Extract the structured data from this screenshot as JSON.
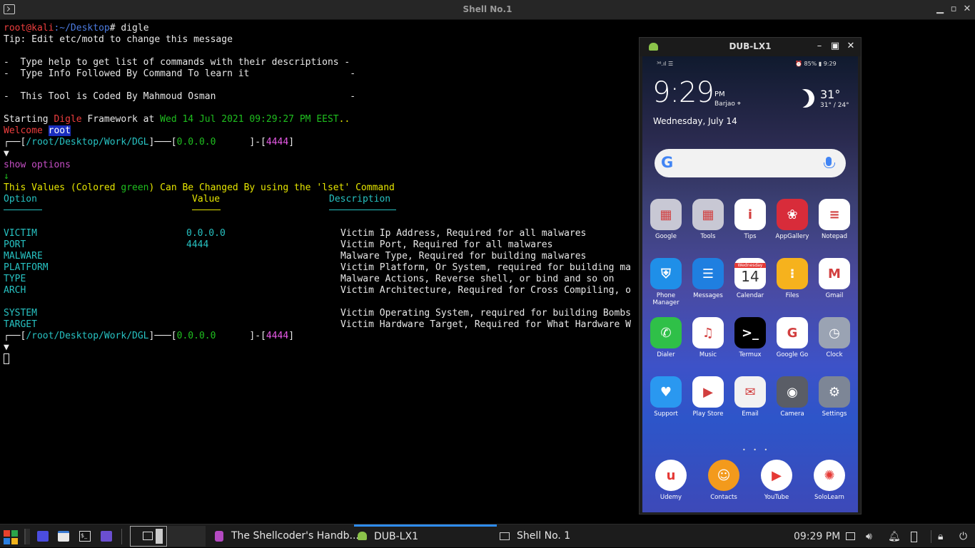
{
  "window": {
    "title": "Shell No.1",
    "controls": [
      "minimize",
      "maximize",
      "close"
    ]
  },
  "terminal": {
    "prompt_user": "root@kali",
    "prompt_path": ":~/Desktop",
    "prompt_suffix": "# ",
    "command": "digle",
    "tip": "Tip: Edit etc/motd to change this message",
    "banner1": "-  Type help to get list of commands with their descriptions -",
    "banner2": "-  Type Info Followed By Command To learn it                  -",
    "banner3": "-  This Tool is Coded By Mahmoud Osman                        -",
    "starting_pre": "Starting ",
    "starting_name": "Digle",
    "starting_mid": " Framework at ",
    "starting_date": "Wed 14 Jul 2021 09:29:27 PM EEST",
    "starting_dots": "..",
    "welcome": "Welcome ",
    "welcome_user": "root",
    "p_box_open": "┌──[",
    "p_path": "/root/Desktop/Work/DGL",
    "p_mid": "]───[",
    "p_ip": "0.0.0.0      ",
    "p_sep": "]-[",
    "p_port": "4444",
    "p_close": "]",
    "p_arrow": "▼",
    "cmd2": "show options",
    "cmd2_arrow": "↓",
    "values_pre": "This Values (Colored ",
    "values_green": "green",
    "values_post": ") Can Be Changed By using the 'lset' Command",
    "headers": {
      "option": "Option",
      "value": "Value",
      "description": "Description"
    },
    "options": [
      {
        "name": "VICTIM",
        "value": "0.0.0.0",
        "desc": "Victim Ip Address, Required for all malwares"
      },
      {
        "name": "PORT",
        "value": "4444",
        "desc": "Victim Port, Required for all malwares"
      },
      {
        "name": "MALWARE",
        "value": "",
        "desc": "Malware Type, Required for building malwares"
      },
      {
        "name": "PLATFORM",
        "value": "",
        "desc": "Victim Platform, Or System, required for building ma"
      },
      {
        "name": "TYPE",
        "value": "",
        "desc": "Malware Actions, Reverse shell, or bind and so on"
      },
      {
        "name": "ARCH",
        "value": "",
        "desc": "Victim Architecture, Required for Cross Compiling, o"
      },
      {
        "name": "SYSTEM",
        "value": "",
        "desc": "Victim Operating System, required for building Bombs"
      },
      {
        "name": "TARGET",
        "value": "",
        "desc": "Victim Hardware Target, Required for What Hardware W"
      }
    ]
  },
  "phone_window": {
    "title": "DUB-LX1",
    "status_left": "³⁶.ıl ☰",
    "status_right": "⏰ 85% ▮ 9:29",
    "clock_time": "9:29",
    "clock_ampm": "PM",
    "clock_location": "Barjao ⌖",
    "date": "Wednesday, July 14",
    "weather_temp": "31°",
    "weather_range": "31° / 24°",
    "search_logo": "G",
    "calendar_day": "Wednesday",
    "calendar_num": "14",
    "apps": [
      {
        "label": "Google",
        "icon": "folder-icon",
        "color": "#c8c8d4"
      },
      {
        "label": "Tools",
        "icon": "folder-icon",
        "color": "#c8c8d4"
      },
      {
        "label": "Tips",
        "icon": "tips-icon",
        "color": "#ffffff"
      },
      {
        "label": "AppGallery",
        "icon": "huawei-icon",
        "color": "#d82c3a"
      },
      {
        "label": "Notepad",
        "icon": "notepad-icon",
        "color": "#ffffff"
      },
      {
        "label": "Phone Manager",
        "icon": "shield-icon",
        "color": "#1f8fe8"
      },
      {
        "label": "Messages",
        "icon": "chat-icon",
        "color": "#1f7fe0"
      },
      {
        "label": "Calendar",
        "icon": "calendar-icon",
        "color": "#ffffff"
      },
      {
        "label": "Files",
        "icon": "files-icon",
        "color": "#f6b21d"
      },
      {
        "label": "Gmail",
        "icon": "gmail-icon",
        "color": "#ffffff"
      },
      {
        "label": "Dialer",
        "icon": "phone-icon",
        "color": "#2fc048"
      },
      {
        "label": "Music",
        "icon": "music-icon",
        "color": "#ffffff"
      },
      {
        "label": "Termux",
        "icon": "termux-icon",
        "color": "#000000"
      },
      {
        "label": "Google Go",
        "icon": "google-go-icon",
        "color": "#ffffff"
      },
      {
        "label": "Clock",
        "icon": "clock-icon",
        "color": "#9aa3b3"
      },
      {
        "label": "Support",
        "icon": "support-icon",
        "color": "#2a98f0"
      },
      {
        "label": "Play Store",
        "icon": "play-store-icon",
        "color": "#ffffff"
      },
      {
        "label": "Email",
        "icon": "email-icon",
        "color": "#f2f2f2"
      },
      {
        "label": "Camera",
        "icon": "camera-icon",
        "color": "#5a5d66"
      },
      {
        "label": "Settings",
        "icon": "settings-icon",
        "color": "#7d8696"
      }
    ],
    "dock": [
      {
        "label": "Udemy",
        "icon": "udemy-icon",
        "color": "#ffffff"
      },
      {
        "label": "Contacts",
        "icon": "contacts-icon",
        "color": "#f39a1c"
      },
      {
        "label": "YouTube",
        "icon": "youtube-icon",
        "color": "#ffffff"
      },
      {
        "label": "SoloLearn",
        "icon": "sololearn-icon",
        "color": "#ffffff"
      }
    ]
  },
  "taskbar": {
    "items": [
      {
        "label": "The Shellcoder's Handb...",
        "icon": "pdf-reader-icon"
      },
      {
        "label": "DUB-LX1",
        "icon": "android-icon"
      },
      {
        "label": "Shell No. 1",
        "icon": "terminal-icon"
      }
    ],
    "clock": "09:29 PM"
  }
}
